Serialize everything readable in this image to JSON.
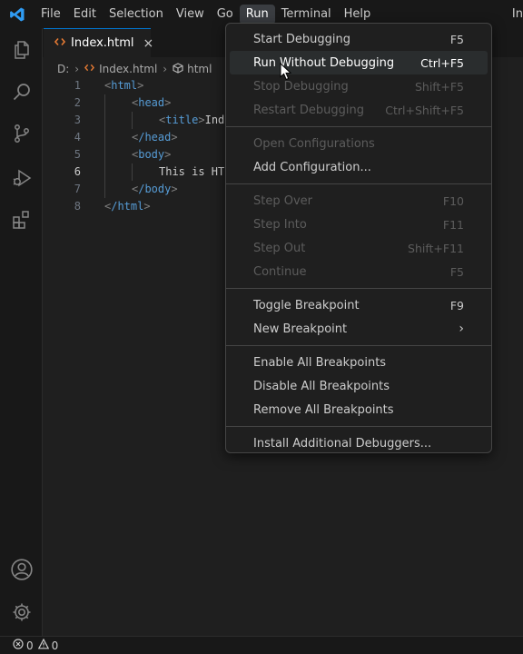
{
  "menubar": {
    "items": [
      "File",
      "Edit",
      "Selection",
      "View",
      "Go",
      "Run",
      "Terminal",
      "Help"
    ],
    "active": "Run",
    "title_fragment": "In"
  },
  "colors": {
    "accent": "#0078d4",
    "tag": "#569cd6",
    "logo": "#2f9cf4"
  },
  "activity_icons": [
    "explorer-icon",
    "search-icon",
    "source-control-icon",
    "run-debug-icon",
    "extensions-icon",
    "account-icon",
    "manage-gear-icon"
  ],
  "tab": {
    "label": "Index.html",
    "close": "×"
  },
  "breadcrumb": {
    "drive": "D:",
    "file": "Index.html",
    "element": "html"
  },
  "editor": {
    "current_line": 6,
    "lines": [
      {
        "num": "1",
        "tag": "html",
        "text": ""
      },
      {
        "num": "2",
        "tag": "head",
        "text": ""
      },
      {
        "num": "3",
        "tag": "title",
        "text": "Ind"
      },
      {
        "num": "4",
        "tag": "/head",
        "text": ""
      },
      {
        "num": "5",
        "tag": "body",
        "text": ""
      },
      {
        "num": "6",
        "tag": "",
        "text": "This is HT"
      },
      {
        "num": "7",
        "tag": "/body",
        "text": ""
      },
      {
        "num": "8",
        "tag": "/html",
        "text": ""
      }
    ]
  },
  "run_menu": {
    "groups": [
      [
        {
          "label": "Start Debugging",
          "key": "F5",
          "disabled": false
        },
        {
          "label": "Run Without Debugging",
          "key": "Ctrl+F5",
          "disabled": false,
          "highlight": true
        },
        {
          "label": "Stop Debugging",
          "key": "Shift+F5",
          "disabled": true
        },
        {
          "label": "Restart Debugging",
          "key": "Ctrl+Shift+F5",
          "disabled": true
        }
      ],
      [
        {
          "label": "Open Configurations",
          "key": "",
          "disabled": true
        },
        {
          "label": "Add Configuration...",
          "key": "",
          "disabled": false
        }
      ],
      [
        {
          "label": "Step Over",
          "key": "F10",
          "disabled": true
        },
        {
          "label": "Step Into",
          "key": "F11",
          "disabled": true
        },
        {
          "label": "Step Out",
          "key": "Shift+F11",
          "disabled": true
        },
        {
          "label": "Continue",
          "key": "F5",
          "disabled": true
        }
      ],
      [
        {
          "label": "Toggle Breakpoint",
          "key": "F9",
          "disabled": false
        },
        {
          "label": "New Breakpoint",
          "key": "",
          "disabled": false,
          "submenu": true
        }
      ],
      [
        {
          "label": "Enable All Breakpoints",
          "key": "",
          "disabled": false
        },
        {
          "label": "Disable All Breakpoints",
          "key": "",
          "disabled": false
        },
        {
          "label": "Remove All Breakpoints",
          "key": "",
          "disabled": false
        }
      ],
      [
        {
          "label": "Install Additional Debuggers...",
          "key": "",
          "disabled": false
        }
      ]
    ]
  },
  "statusbar": {
    "errors": "0",
    "warnings": "0"
  }
}
